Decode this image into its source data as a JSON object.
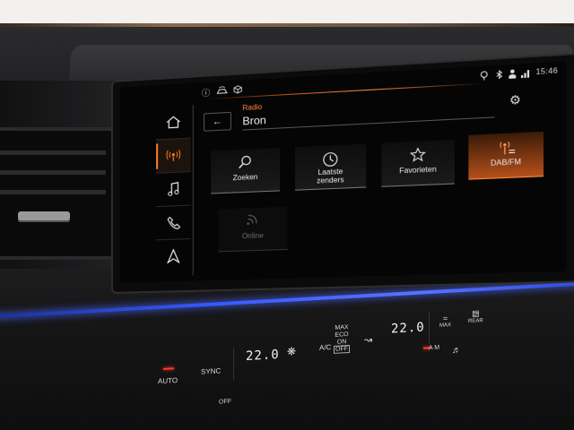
{
  "status_bar": {
    "left_icons": [
      "info-icon",
      "car-signal-icon",
      "package-icon"
    ],
    "right_icons": [
      "location-icon",
      "bluetooth-icon",
      "person-icon",
      "signal-icon"
    ],
    "time": "15:46"
  },
  "sidebar": {
    "items": [
      {
        "name": "home",
        "icon": "home-icon",
        "active": false
      },
      {
        "name": "radio",
        "icon": "radio-icon",
        "active": true
      },
      {
        "name": "media",
        "icon": "music-icon",
        "active": false
      },
      {
        "name": "phone",
        "icon": "phone-icon",
        "active": false
      },
      {
        "name": "navigation",
        "icon": "navigation-icon",
        "active": false
      }
    ]
  },
  "header": {
    "category": "Radio",
    "title": "Bron"
  },
  "tiles": [
    {
      "label": "Zoeken",
      "icon": "search-icon",
      "state": "normal"
    },
    {
      "label": "Laatste zenders",
      "icon": "history-icon",
      "state": "normal"
    },
    {
      "label": "Favorieten",
      "icon": "star-icon",
      "state": "normal"
    },
    {
      "label": "DAB/FM",
      "icon": "dab-icon",
      "state": "active"
    },
    {
      "label": "Online",
      "icon": "online-icon",
      "state": "disabled"
    }
  ],
  "climate": {
    "auto": "AUTO",
    "sync": "SYNC",
    "off": "OFF",
    "temp_left": "22.0",
    "temp_right": "22.0",
    "ac": "A/C",
    "max_eco": "MAX",
    "eco": "ECO",
    "on": "ON",
    "off_small": "OFF",
    "max_defrost": "MAX",
    "rear": "REAR",
    "a_m": "A",
    "m": "M"
  },
  "colors": {
    "accent": "#ff7a24",
    "ambient": "#3c5cff",
    "led": "#ff3b2f"
  }
}
